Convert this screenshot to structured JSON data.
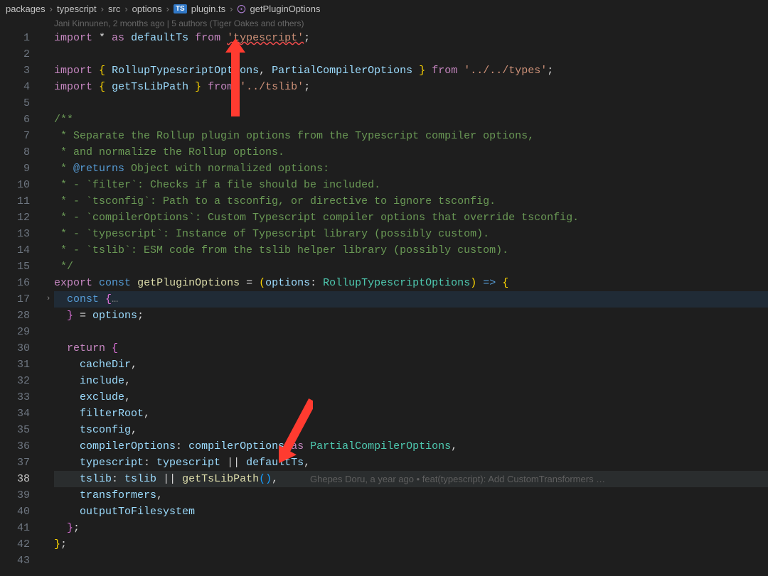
{
  "breadcrumb": {
    "parts": [
      "packages",
      "typescript",
      "src",
      "options"
    ],
    "file": "plugin.ts",
    "symbol": "getPluginOptions"
  },
  "authors_line": "Jani Kinnunen, 2 months ago | 5 authors (Tiger Oakes and others)",
  "gutter_lines": [
    "1",
    "2",
    "3",
    "4",
    "5",
    "6",
    "7",
    "8",
    "9",
    "10",
    "11",
    "12",
    "13",
    "14",
    "15",
    "16",
    "17",
    "28",
    "29",
    "30",
    "31",
    "32",
    "33",
    "34",
    "35",
    "36",
    "37",
    "38",
    "39",
    "40",
    "41",
    "42",
    "43"
  ],
  "current_line": "38",
  "fold_line": "17",
  "blame": "Ghepes Doru, a year ago • feat(typescript): Add CustomTransformers …",
  "code_lines": {
    "1": {
      "pre": "",
      "kw": "import",
      "sp": " * ",
      "kw2": "as",
      "sp2": " ",
      "var": "defaultTs",
      "sp3": " ",
      "kw3": "from",
      "sp4": " ",
      "str": "'typescript'",
      "semi": ";"
    },
    "2": {
      "text": ""
    },
    "3": {
      "pre": "",
      "kw": "import",
      "sp": " ",
      "ob": "{",
      "sp2": " ",
      "var": "RollupTypescriptOptions",
      "c": ",",
      "sp3": " ",
      "var2": "PartialCompilerOptions",
      "sp4": " ",
      "cb": "}",
      "sp5": " ",
      "kw2": "from",
      "sp6": " ",
      "str": "'../../types'",
      "semi": ";"
    },
    "4": {
      "pre": "",
      "kw": "import",
      "sp": " ",
      "ob": "{",
      "sp2": " ",
      "var": "getTsLibPath",
      "sp3": " ",
      "cb": "}",
      "sp4": " ",
      "kw2": "from",
      "sp5": " ",
      "str": "'../tslib'",
      "semi": ";"
    },
    "5": {
      "text": ""
    },
    "6": {
      "comment": "/**"
    },
    "7": {
      "comment": " * Separate the Rollup plugin options from the Typescript compiler options,"
    },
    "8": {
      "comment": " * and normalize the Rollup options."
    },
    "9": {
      "comment_pre": " * ",
      "tag": "@returns",
      "comment_rest": " Object with normalized options:"
    },
    "10": {
      "comment": " * - `filter`: Checks if a file should be included."
    },
    "11": {
      "comment": " * - `tsconfig`: Path to a tsconfig, or directive to ignore tsconfig."
    },
    "12": {
      "comment": " * - `compilerOptions`: Custom Typescript compiler options that override tsconfig."
    },
    "13": {
      "comment": " * - `typescript`: Instance of Typescript library (possibly custom)."
    },
    "14": {
      "comment": " * - `tslib`: ESM code from the tslib helper library (possibly custom)."
    },
    "15": {
      "comment": " */"
    },
    "16": {
      "kw": "export",
      "sp": " ",
      "const": "const",
      "sp2": " ",
      "fn": "getPluginOptions",
      "sp3": " = ",
      "ob": "(",
      "var": "options",
      "colon": ": ",
      "type": "RollupTypescriptOptions",
      "cb": ")",
      "sp4": " ",
      "arrow": "=>",
      "sp5": " ",
      "obr": "{"
    },
    "17": {
      "indent": "  ",
      "const": "const",
      "sp": " ",
      "ob": "{",
      "ell": "…"
    },
    "28": {
      "indent": "  ",
      "cb": "}",
      "sp": " = ",
      "var": "options",
      "semi": ";"
    },
    "29": {
      "text": ""
    },
    "30": {
      "indent": "  ",
      "kw": "return",
      "sp": " ",
      "ob": "{"
    },
    "31": {
      "indent": "    ",
      "prop": "cacheDir",
      "c": ","
    },
    "32": {
      "indent": "    ",
      "prop": "include",
      "c": ","
    },
    "33": {
      "indent": "    ",
      "prop": "exclude",
      "c": ","
    },
    "34": {
      "indent": "    ",
      "prop": "filterRoot",
      "c": ","
    },
    "35": {
      "indent": "    ",
      "prop": "tsconfig",
      "c": ","
    },
    "36": {
      "indent": "    ",
      "prop": "compilerOptions",
      "colon": ": ",
      "var": "compilerOptions",
      "sp": " ",
      "kw": "as",
      "sp2": " ",
      "type": "PartialCompilerOptions",
      "c": ","
    },
    "37": {
      "indent": "    ",
      "prop": "typescript",
      "colon": ": ",
      "var": "typescript",
      "sp": " || ",
      "var2": "defaultTs",
      "c": ","
    },
    "38": {
      "indent": "    ",
      "prop": "tslib",
      "colon": ": ",
      "var": "tslib",
      "sp": " || ",
      "fn": "getTsLibPath",
      "paren": "()",
      "c": ","
    },
    "39": {
      "indent": "    ",
      "prop": "transformers",
      "c": ","
    },
    "40": {
      "indent": "    ",
      "prop": "outputToFilesystem"
    },
    "41": {
      "indent": "  ",
      "cb": "}",
      "semi": ";"
    },
    "42": {
      "cb": "}",
      "semi": ";"
    },
    "43": {
      "text": ""
    }
  }
}
